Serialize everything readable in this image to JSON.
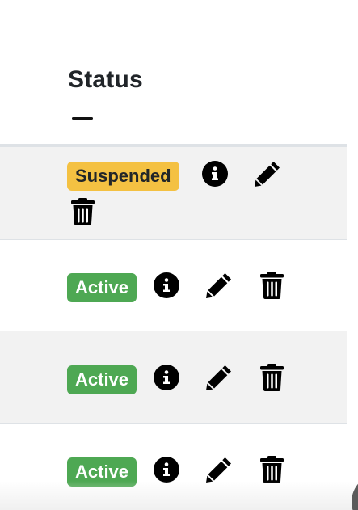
{
  "table": {
    "header": {
      "status_label": "Status"
    },
    "rows": [
      {
        "status": "Suspended",
        "status_color": "#f4c142",
        "actions": [
          "info-icon",
          "edit-icon",
          "delete-icon"
        ]
      },
      {
        "status": "Active",
        "status_color": "#4ea853",
        "actions": [
          "info-icon",
          "edit-icon",
          "delete-icon"
        ]
      },
      {
        "status": "Active",
        "status_color": "#4ea853",
        "actions": [
          "info-icon",
          "edit-icon",
          "delete-icon"
        ]
      },
      {
        "status": "Active",
        "status_color": "#4ea853",
        "actions": [
          "info-icon",
          "edit-icon",
          "delete-icon"
        ]
      }
    ]
  }
}
